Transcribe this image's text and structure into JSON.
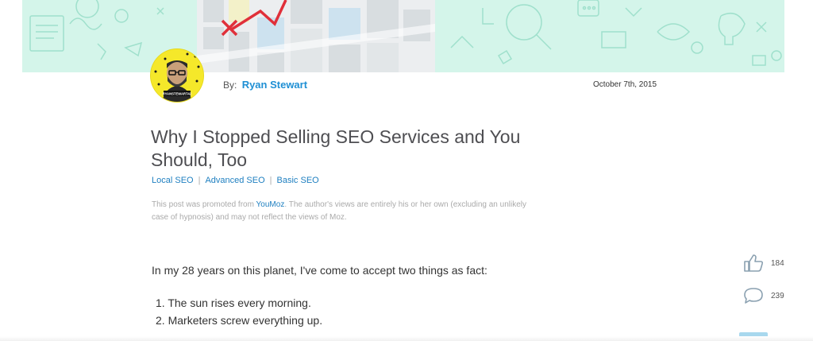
{
  "author": {
    "by_label": "By:",
    "name": "Ryan Stewart",
    "avatar_caption": "RYANSTEWART42"
  },
  "post": {
    "date": "October 7th, 2015",
    "title": "Why I Stopped Selling SEO Services and You Should, Too",
    "categories": [
      "Local SEO",
      "Advanced SEO",
      "Basic SEO"
    ],
    "separator": "|",
    "promo": {
      "prefix": "This post was promoted from ",
      "source": "YouMoz",
      "suffix": ". The author's views are entirely his or her own (excluding an unlikely case of hypnosis) and may not reflect the views of Moz."
    },
    "intro": "In my 28 years on this planet, I've come to accept two things as fact:",
    "list": [
      "The sun rises every morning.",
      "Marketers screw everything up."
    ]
  },
  "social": {
    "likes": "184",
    "comments": "239"
  },
  "colors": {
    "hero_bg": "#d4f5ea",
    "link": "#1e8fd4",
    "avatar_bg": "#f5e82a",
    "map_route": "#e0303a"
  },
  "icons": [
    "thumbs-up-icon",
    "comment-icon"
  ]
}
